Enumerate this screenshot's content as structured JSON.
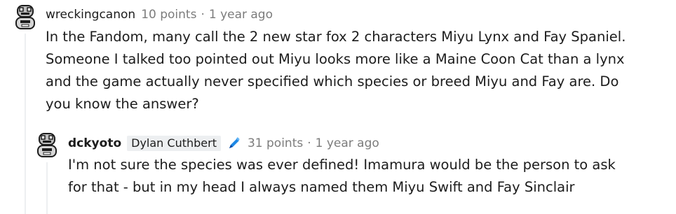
{
  "comments": [
    {
      "author": "wreckingcanon",
      "points": "10 points",
      "separator": "·",
      "time": "1 year ago",
      "body": "In the Fandom, many call the 2 new star fox 2 characters Miyu Lynx and Fay Spaniel. Someone I talked too pointed out Miyu looks more like a Maine Coon Cat than a lynx and the game actually never specified which species or breed Miyu and Fay are. Do you know the answer?",
      "avatar_icon": "pixel-avatar-icon"
    },
    {
      "author": "dckyoto",
      "flair": "Dylan Cuthbert",
      "flair_icon": "pencil-icon",
      "points": "31 points",
      "separator": "·",
      "time": "1 year ago",
      "body": "I'm not sure the species was ever defined! Imamura would be the person to ask for that - but in my head I always named them Miyu Swift and Fay Sinclair",
      "avatar_icon": "pixel-avatar-icon"
    }
  ],
  "colors": {
    "text": "#1c1c1c",
    "meta": "#7c7c7c",
    "flair_bg": "#edeff1",
    "thread_line": "#edeff1",
    "pencil": "#1e88e5"
  }
}
